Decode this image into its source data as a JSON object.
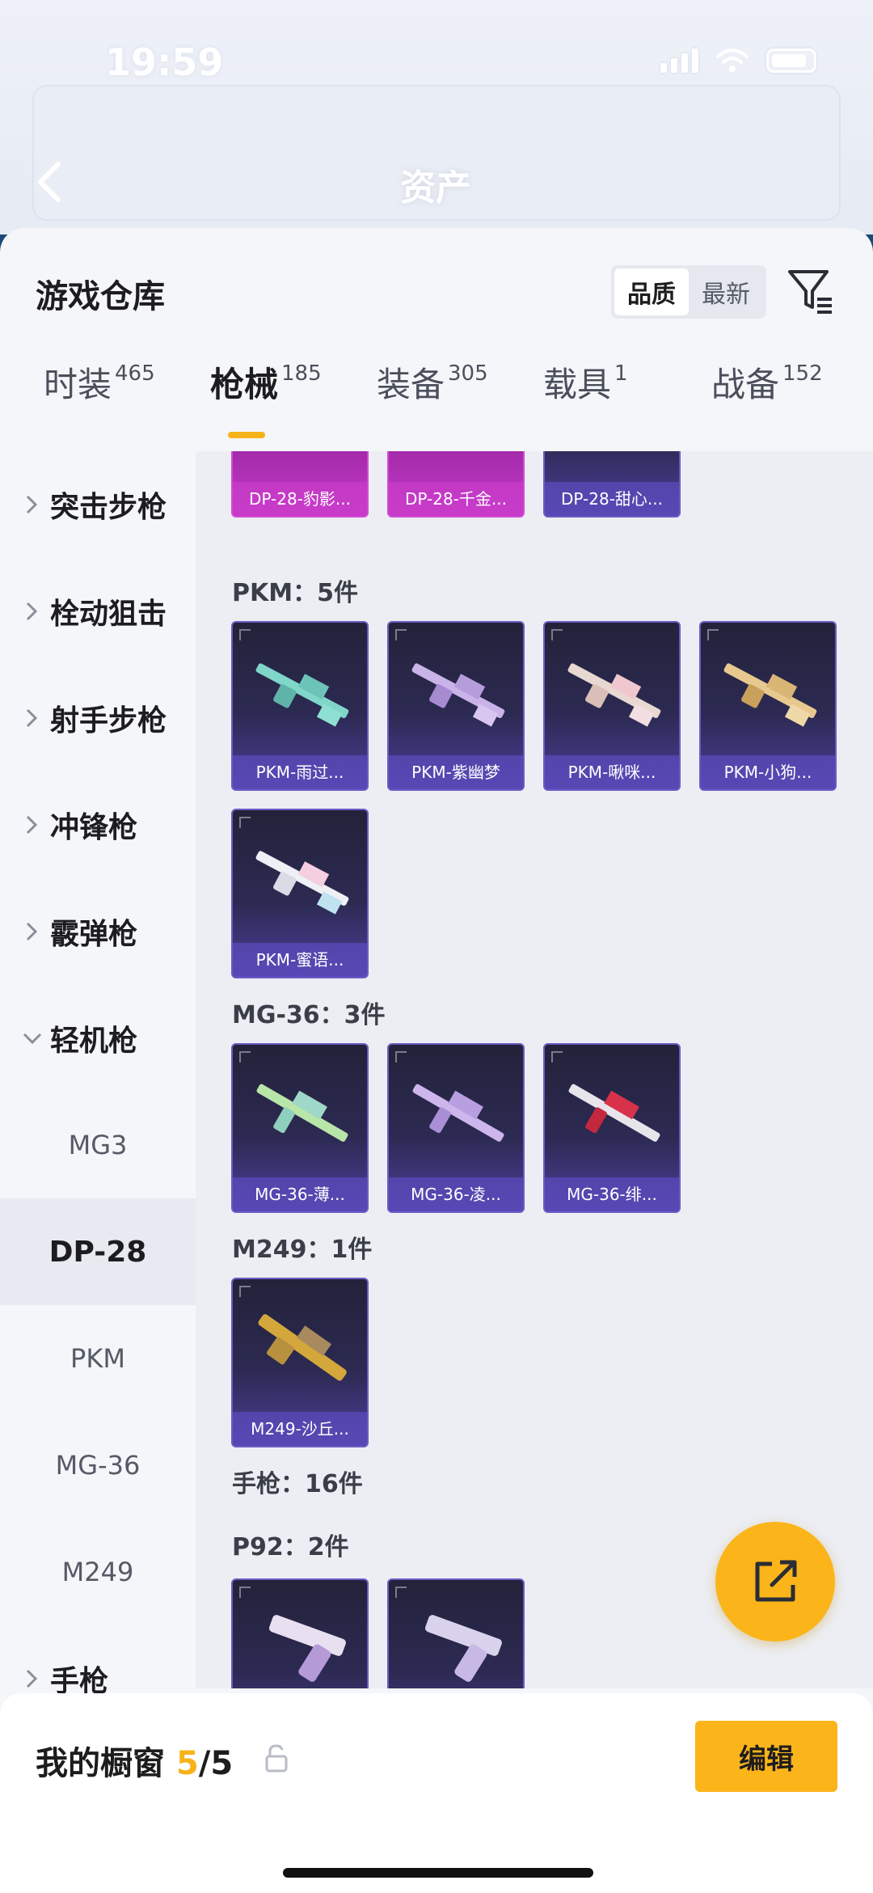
{
  "status_bar": {
    "time": "19:59"
  },
  "background_header": {
    "title": "资产"
  },
  "sheet": {
    "title": "游戏仓库",
    "sort": {
      "options": [
        "品质",
        "最新"
      ],
      "active": "品质"
    }
  },
  "tabs": [
    {
      "label": "时装",
      "count": "465"
    },
    {
      "label": "枪械",
      "count": "185"
    },
    {
      "label": "装备",
      "count": "305"
    },
    {
      "label": "载具",
      "count": "1"
    },
    {
      "label": "战备",
      "count": "152"
    }
  ],
  "sidebar": {
    "categories": [
      {
        "label": "突击步枪"
      },
      {
        "label": "栓动狙击"
      },
      {
        "label": "射手步枪"
      },
      {
        "label": "冲锋枪"
      },
      {
        "label": "霰弹枪"
      },
      {
        "label": "轻机枪"
      }
    ],
    "subs": [
      {
        "label": "MG3"
      },
      {
        "label": "DP-28"
      },
      {
        "label": "PKM"
      },
      {
        "label": "MG-36"
      },
      {
        "label": "M249"
      }
    ],
    "last_category": {
      "label": "手枪"
    }
  },
  "content": {
    "dp28_items": [
      "DP-28-豹影...",
      "DP-28-千金...",
      "DP-28-甜心..."
    ],
    "pkm": {
      "title": "PKM：5件",
      "items": [
        "PKM-雨过...",
        "PKM-紫幽梦",
        "PKM-啾咪...",
        "PKM-小狗...",
        "PKM-蜜语..."
      ]
    },
    "mg36": {
      "title": "MG-36：3件",
      "items": [
        "MG-36-薄...",
        "MG-36-凌...",
        "MG-36-绯..."
      ]
    },
    "m249": {
      "title": "M249：1件",
      "items": [
        "M249-沙丘..."
      ]
    },
    "pistol": {
      "title": "手枪：16件"
    },
    "p92": {
      "title": "P92：2件"
    }
  },
  "bottom": {
    "showcase_label": "我的橱窗",
    "showcase_count": "5",
    "showcase_total": "/5",
    "edit_label": "编辑"
  },
  "colors": {
    "accent": "#fbb41a",
    "tab_underline": "#f6b319"
  }
}
